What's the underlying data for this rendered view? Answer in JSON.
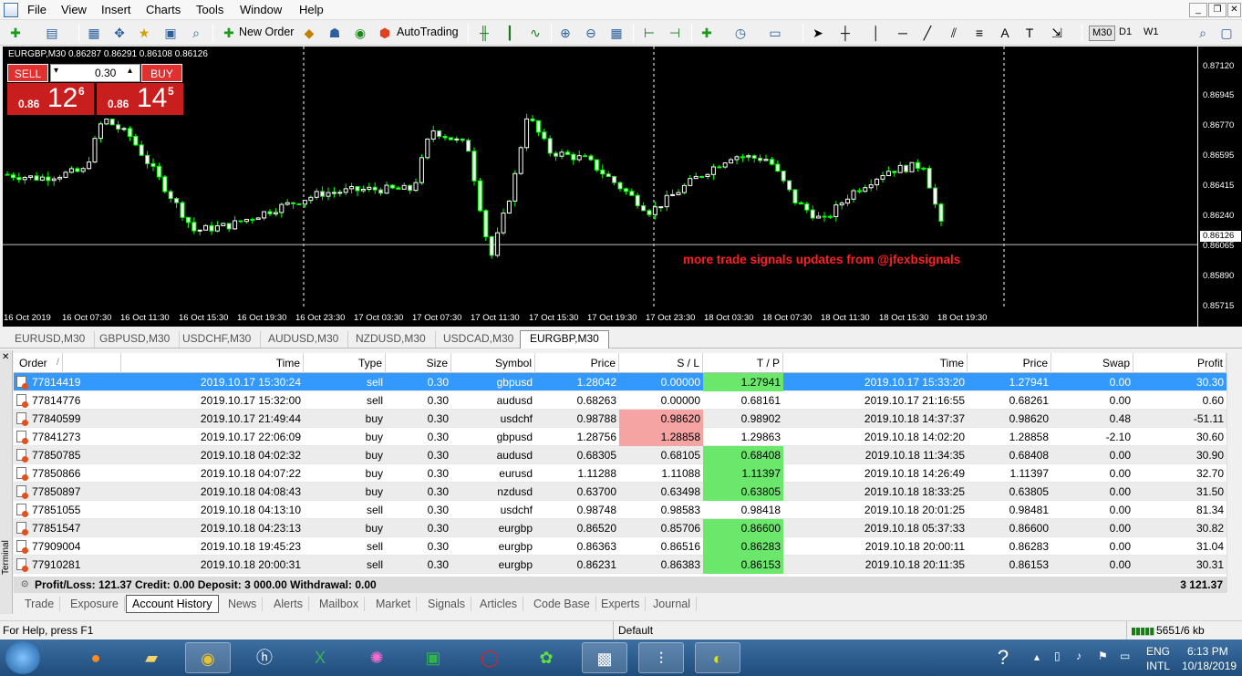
{
  "menu": [
    "File",
    "View",
    "Insert",
    "Charts",
    "Tools",
    "Window",
    "Help"
  ],
  "toolbar": {
    "new_order": "New Order",
    "autotrading": "AutoTrading",
    "timeframes": [
      "M30",
      "D1",
      "W1"
    ]
  },
  "chart": {
    "title": "EURGBP,M30  0.86287 0.86291 0.86108 0.86126",
    "current_price": "0.86126",
    "y_ticks": [
      "0.87120",
      "0.86945",
      "0.86770",
      "0.86595",
      "0.86415",
      "0.86240",
      "0.86065",
      "0.85890",
      "0.85715"
    ],
    "x_ticks": [
      "16 Oct 2019",
      "16 Oct 07:30",
      "16 Oct 11:30",
      "16 Oct 15:30",
      "16 Oct 19:30",
      "16 Oct 23:30",
      "17 Oct 03:30",
      "17 Oct 07:30",
      "17 Oct 11:30",
      "17 Oct 15:30",
      "17 Oct 19:30",
      "17 Oct 23:30",
      "18 Oct 03:30",
      "18 Oct 07:30",
      "18 Oct 11:30",
      "18 Oct 15:30",
      "18 Oct 19:30"
    ],
    "watermark": "more trade signals updates from @jfexbsignals",
    "colors": {
      "background": "#000000",
      "bull": "#ffffff",
      "bear": "#00ff00",
      "watermark": "#ff2020"
    }
  },
  "oneclick": {
    "sell_label": "SELL",
    "buy_label": "BUY",
    "lots": "0.30",
    "sell_prefix": "0.86",
    "sell_big": "12",
    "sell_sup": "6",
    "buy_prefix": "0.86",
    "buy_big": "14",
    "buy_sup": "5"
  },
  "chart_tabs": [
    "EURUSD,M30",
    "GBPUSD,M30",
    "USDCHF,M30",
    "AUDUSD,M30",
    "NZDUSD,M30",
    "USDCAD,M30",
    "EURGBP,M30"
  ],
  "history": {
    "columns": [
      "Order",
      "Time",
      "Type",
      "Size",
      "Symbol",
      "Price",
      "S / L",
      "T / P",
      "Time",
      "Price",
      "Swap",
      "Profit"
    ],
    "sort_marker": "/",
    "rows": [
      [
        "77814419",
        "2019.10.17 15:30:24",
        "sell",
        "0.30",
        "gbpusd",
        "1.28042",
        "0.00000",
        "1.27941",
        "2019.10.17 15:33:20",
        "1.27941",
        "0.00",
        "30.30"
      ],
      [
        "77814776",
        "2019.10.17 15:32:00",
        "sell",
        "0.30",
        "audusd",
        "0.68263",
        "0.00000",
        "0.68161",
        "2019.10.17 21:16:55",
        "0.68261",
        "0.00",
        "0.60"
      ],
      [
        "77840599",
        "2019.10.17 21:49:44",
        "buy",
        "0.30",
        "usdchf",
        "0.98788",
        "0.98620",
        "0.98902",
        "2019.10.18 14:37:37",
        "0.98620",
        "0.48",
        "-51.11"
      ],
      [
        "77841273",
        "2019.10.17 22:06:09",
        "buy",
        "0.30",
        "gbpusd",
        "1.28756",
        "1.28858",
        "1.29863",
        "2019.10.18 14:02:20",
        "1.28858",
        "-2.10",
        "30.60"
      ],
      [
        "77850785",
        "2019.10.18 04:02:32",
        "buy",
        "0.30",
        "audusd",
        "0.68305",
        "0.68105",
        "0.68408",
        "2019.10.18 11:34:35",
        "0.68408",
        "0.00",
        "30.90"
      ],
      [
        "77850866",
        "2019.10.18 04:07:22",
        "buy",
        "0.30",
        "eurusd",
        "1.11288",
        "1.11088",
        "1.11397",
        "2019.10.18 14:26:49",
        "1.11397",
        "0.00",
        "32.70"
      ],
      [
        "77850897",
        "2019.10.18 04:08:43",
        "buy",
        "0.30",
        "nzdusd",
        "0.63700",
        "0.63498",
        "0.63805",
        "2019.10.18 18:33:25",
        "0.63805",
        "0.00",
        "31.50"
      ],
      [
        "77851055",
        "2019.10.18 04:13:10",
        "sell",
        "0.30",
        "usdchf",
        "0.98748",
        "0.98583",
        "0.98418",
        "2019.10.18 20:01:25",
        "0.98481",
        "0.00",
        "81.34"
      ],
      [
        "77851547",
        "2019.10.18 04:23:13",
        "buy",
        "0.30",
        "eurgbp",
        "0.86520",
        "0.85706",
        "0.86600",
        "2019.10.18 05:37:33",
        "0.86600",
        "0.00",
        "30.82"
      ],
      [
        "77909004",
        "2019.10.18 19:45:23",
        "sell",
        "0.30",
        "eurgbp",
        "0.86363",
        "0.86516",
        "0.86283",
        "2019.10.18 20:00:11",
        "0.86283",
        "0.00",
        "31.04"
      ],
      [
        "77910281",
        "2019.10.18 20:00:31",
        "sell",
        "0.30",
        "eurgbp",
        "0.86231",
        "0.86383",
        "0.86153",
        "2019.10.18 20:11:35",
        "0.86153",
        "0.00",
        "30.31"
      ]
    ],
    "tp_highlight": [
      true,
      false,
      false,
      false,
      true,
      true,
      true,
      false,
      true,
      true,
      true
    ],
    "sl_highlight": [
      false,
      false,
      true,
      true,
      false,
      false,
      false,
      false,
      false,
      false,
      false
    ],
    "summary": "Profit/Loss: 121.37  Credit: 0.00  Deposit: 3 000.00  Withdrawal: 0.00",
    "balance": "3 121.37"
  },
  "terminal_label": "Terminal",
  "terminal_tabs": [
    "Trade",
    "Exposure",
    "Account History",
    "News",
    "Alerts",
    "Mailbox",
    "Market",
    "Signals",
    "Articles",
    "Code Base",
    "Experts",
    "Journal"
  ],
  "status": {
    "help": "For Help, press F1",
    "profile": "Default",
    "traffic": "5651/6 kb"
  },
  "taskbar": {
    "lang1": "ENG",
    "lang2": "INTL",
    "time": "6:13 PM",
    "date": "10/18/2019"
  }
}
